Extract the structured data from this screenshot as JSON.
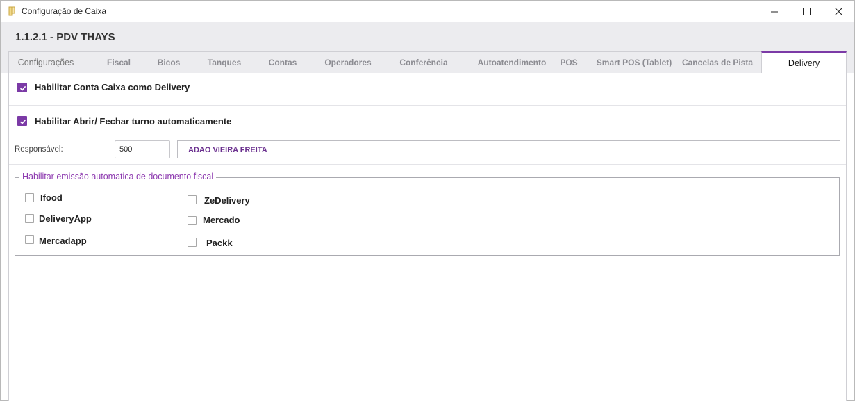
{
  "window": {
    "title": "Configuração de Caixa",
    "controls": {
      "minimize": "minimize-icon",
      "maximize": "maximize-icon",
      "close": "close-icon"
    }
  },
  "header": {
    "title": "1.1.2.1 - PDV THAYS"
  },
  "tabs": [
    {
      "label": "Configurações"
    },
    {
      "label": "Fiscal"
    },
    {
      "label": "Bicos"
    },
    {
      "label": "Tanques"
    },
    {
      "label": "Contas"
    },
    {
      "label": "Operadores"
    },
    {
      "label": "Conferência"
    },
    {
      "label": "Autoatendimento"
    },
    {
      "label": "POS"
    },
    {
      "label": "Smart POS (Tablet)"
    },
    {
      "label": "Cancelas de Pista"
    },
    {
      "label": "Delivery",
      "active": true
    }
  ],
  "delivery": {
    "enable_delivery": {
      "label": "Habilitar Conta Caixa como Delivery",
      "checked": true
    },
    "auto_shift": {
      "label": "Habilitar Abrir/ Fechar turno automaticamente",
      "checked": true
    },
    "responsible": {
      "label": "Responsável:",
      "code": "500",
      "name": "ADAO VIEIRA FREITA"
    },
    "fiscal_group": {
      "title": "Habilitar emissão automatica de documento fiscal",
      "options": [
        {
          "label": "Ifood",
          "checked": false
        },
        {
          "label": "DeliveryApp",
          "checked": false
        },
        {
          "label": "Mercadapp",
          "checked": false
        },
        {
          "label": "ZeDelivery",
          "checked": false
        },
        {
          "label": "Mercado",
          "checked": false
        },
        {
          "label": "Packk",
          "checked": false
        }
      ]
    }
  },
  "colors": {
    "accent": "#7b3aa6",
    "group_title": "#8e3bb0",
    "header_bg": "#ececef"
  }
}
